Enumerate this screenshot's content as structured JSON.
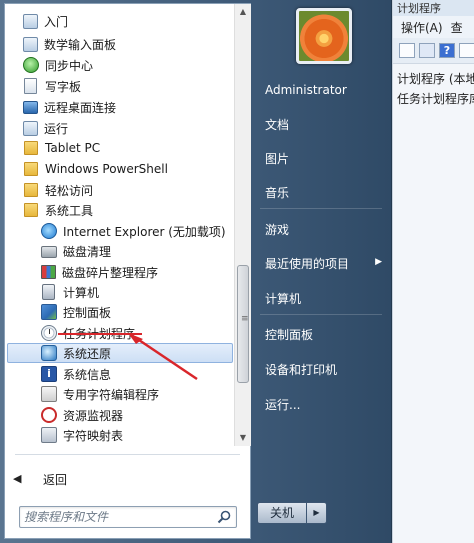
{
  "background_window": {
    "title": "计划程序",
    "menu": [
      "操作(A)",
      "查"
    ],
    "tree": [
      "计划程序 (本地)",
      "任务计划程序库"
    ]
  },
  "programs": [
    {
      "label": "入门",
      "icon": "getting-started-icon",
      "indent": false
    },
    {
      "label": "数学输入面板",
      "icon": "math-input-panel-icon",
      "indent": false
    },
    {
      "label": "同步中心",
      "icon": "sync-center-icon",
      "indent": false
    },
    {
      "label": "写字板",
      "icon": "wordpad-icon",
      "indent": false
    },
    {
      "label": "远程桌面连接",
      "icon": "remote-desktop-icon",
      "indent": false
    },
    {
      "label": "运行",
      "icon": "run-icon",
      "indent": false
    },
    {
      "label": "Tablet PC",
      "icon": "folder-icon",
      "indent": false
    },
    {
      "label": "Windows PowerShell",
      "icon": "folder-icon",
      "indent": false
    },
    {
      "label": "轻松访问",
      "icon": "folder-icon",
      "indent": false
    },
    {
      "label": "系统工具",
      "icon": "folder-icon",
      "indent": false
    },
    {
      "label": "Internet Explorer (无加载项)",
      "icon": "internet-explorer-icon",
      "indent": true
    },
    {
      "label": "磁盘清理",
      "icon": "disk-cleanup-icon",
      "indent": true
    },
    {
      "label": "磁盘碎片整理程序",
      "icon": "disk-defragmenter-icon",
      "indent": true
    },
    {
      "label": "计算机",
      "icon": "computer-icon",
      "indent": true
    },
    {
      "label": "控制面板",
      "icon": "control-panel-icon",
      "indent": true
    },
    {
      "label": "任务计划程序",
      "icon": "task-scheduler-icon",
      "indent": true
    },
    {
      "label": "系统还原",
      "icon": "system-restore-icon",
      "indent": true,
      "selected": true
    },
    {
      "label": "系统信息",
      "icon": "system-information-icon",
      "indent": true
    },
    {
      "label": "专用字符编辑程序",
      "icon": "private-character-editor-icon",
      "indent": true
    },
    {
      "label": "资源监视器",
      "icon": "resource-monitor-icon",
      "indent": true
    },
    {
      "label": "字符映射表",
      "icon": "character-map-icon",
      "indent": true
    }
  ],
  "back_label": "返回",
  "search": {
    "placeholder": "搜索程序和文件"
  },
  "right_pane": {
    "items": [
      {
        "label": "Administrator",
        "has_submenu": false
      },
      {
        "label": "文档",
        "has_submenu": false
      },
      {
        "label": "图片",
        "has_submenu": false
      },
      {
        "label": "音乐",
        "has_submenu": false
      },
      {
        "label": "游戏",
        "has_submenu": false
      },
      {
        "label": "最近使用的项目",
        "has_submenu": true
      },
      {
        "label": "计算机",
        "has_submenu": false
      },
      {
        "label": "控制面板",
        "has_submenu": false
      },
      {
        "label": "设备和打印机",
        "has_submenu": false
      },
      {
        "label": "运行...",
        "has_submenu": false
      }
    ]
  },
  "shutdown": {
    "label": "关机",
    "options_icon": "triangle-right-icon"
  },
  "annotation": {
    "color": "#d9262b"
  }
}
